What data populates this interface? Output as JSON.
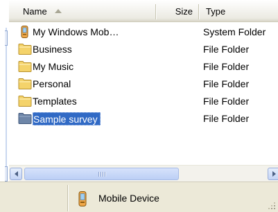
{
  "columns": {
    "name": "Name",
    "size": "Size",
    "type": "Type"
  },
  "files": [
    {
      "name": "My Windows Mob…",
      "type": "System Folder",
      "icon": "mobile-device-icon",
      "selected": false
    },
    {
      "name": "Business",
      "type": "File Folder",
      "icon": "folder-icon",
      "selected": false
    },
    {
      "name": "My Music",
      "type": "File Folder",
      "icon": "folder-icon",
      "selected": false
    },
    {
      "name": "Personal",
      "type": "File Folder",
      "icon": "folder-icon",
      "selected": false
    },
    {
      "name": "Templates",
      "type": "File Folder",
      "icon": "folder-icon",
      "selected": false
    },
    {
      "name": "Sample survey",
      "type": "File Folder",
      "icon": "folder-icon",
      "selected": true
    }
  ],
  "status": {
    "text": "Mobile Device",
    "icon": "mobile-device-icon"
  },
  "colors": {
    "selection": "#316ac5",
    "folder": "#f4d36b",
    "header": "#ebeae2",
    "statusbar": "#ece9d8"
  }
}
